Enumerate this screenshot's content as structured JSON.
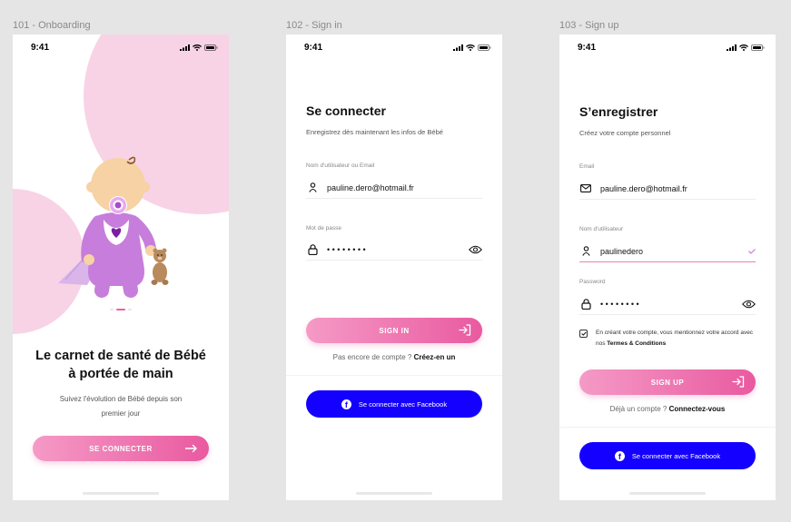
{
  "frames": {
    "onboarding": {
      "label": "101 - Onboarding"
    },
    "signin": {
      "label": "102 - Sign in"
    },
    "signup": {
      "label": "103 - Sign up"
    }
  },
  "status": {
    "time": "9:41"
  },
  "onboarding": {
    "title": "Le carnet de santé de Bébé\nà portée de main",
    "subtitle": "Suivez l'évolution de Bébé depuis son\npremier jour",
    "cta": "SE CONNECTER",
    "pager": {
      "count": 3,
      "active": 1
    }
  },
  "signin": {
    "title": "Se connecter",
    "subtitle": "Enregistrez dès maintenant les infos de Bébé",
    "username_label": "Nom d'utilisateur ou Email",
    "username_value": "pauline.dero@hotmail.fr",
    "password_label": "Mot de passe",
    "password_value": "••••••••",
    "cta": "SIGN IN",
    "alt_text": "Pas encore de compte ?",
    "alt_link": "Créez-en un",
    "facebook": "Se connecter avec Facebook"
  },
  "signup": {
    "title": "S’enregistrer",
    "subtitle": "Créez votre compte personnel",
    "email_label": "Email",
    "email_value": "pauline.dero@hotmail.fr",
    "username_label": "Nom d'utilisateur",
    "username_value": "paulinedero",
    "password_label": "Password",
    "password_value": "••••••••",
    "terms_prefix": "En créant votre compte, vous mentionnez votre accord avec nos",
    "terms_link": "Termes & Conditions",
    "cta": "SIGN UP",
    "alt_text": "Déjà un compte ?",
    "alt_link": "Connectez-vous",
    "facebook": "Se connecter avec Facebook"
  },
  "colors": {
    "accent_pink": "#e95aa0",
    "pink_light": "#f8d3e6",
    "facebook_blue": "#1400ff",
    "baby_purple": "#c77ddb"
  },
  "icons": [
    "signal-icon",
    "wifi-icon",
    "battery-icon",
    "user-icon",
    "lock-icon",
    "eye-icon",
    "mail-icon",
    "check-icon",
    "arrow-right-icon",
    "login-arrow-icon",
    "facebook-icon",
    "baby-illustration",
    "teddy-bear-illustration"
  ]
}
